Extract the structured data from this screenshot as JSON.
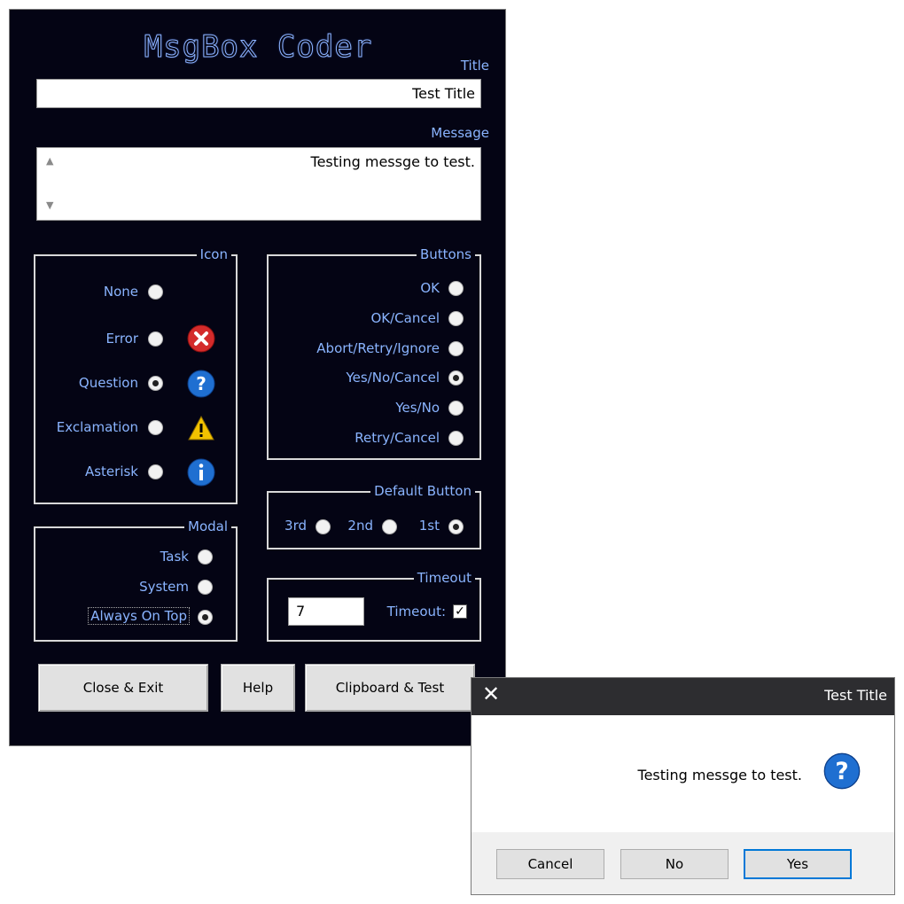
{
  "app": {
    "title": "MsgBox Coder"
  },
  "fields": {
    "title_label": "Title",
    "title_value": "Test Title",
    "message_label": "Message",
    "message_value": "Testing messge to test."
  },
  "icon_group": {
    "legend": "Icon",
    "options": [
      {
        "label": "None",
        "checked": false,
        "icon": "none"
      },
      {
        "label": "Error",
        "checked": false,
        "icon": "error-icon"
      },
      {
        "label": "Question",
        "checked": true,
        "icon": "question-icon"
      },
      {
        "label": "Exclamation",
        "checked": false,
        "icon": "warning-icon"
      },
      {
        "label": "Asterisk",
        "checked": false,
        "icon": "info-icon"
      }
    ]
  },
  "buttons_group": {
    "legend": "Buttons",
    "options": [
      {
        "label": "OK",
        "checked": false
      },
      {
        "label": "OK/Cancel",
        "checked": false
      },
      {
        "label": "Abort/Retry/Ignore",
        "checked": false
      },
      {
        "label": "Yes/No/Cancel",
        "checked": true
      },
      {
        "label": "Yes/No",
        "checked": false
      },
      {
        "label": "Retry/Cancel",
        "checked": false
      }
    ]
  },
  "default_button_group": {
    "legend": "Default Button",
    "options": [
      {
        "label": "1st",
        "checked": true
      },
      {
        "label": "2nd",
        "checked": false
      },
      {
        "label": "3rd",
        "checked": false
      }
    ]
  },
  "modal_group": {
    "legend": "Modal",
    "options": [
      {
        "label": "Task",
        "checked": false
      },
      {
        "label": "System",
        "checked": false
      },
      {
        "label": "Always On Top",
        "checked": true
      }
    ]
  },
  "timeout_group": {
    "legend": "Timeout",
    "checkbox_label": "Timeout:",
    "checked": true,
    "value": "7"
  },
  "actions": {
    "clipboard_test": "Clipboard & Test",
    "help": "Help",
    "close_exit": "Close & Exit"
  },
  "dialog": {
    "title": "Test Title",
    "message": "Testing messge to test.",
    "icon": "question-icon",
    "buttons": [
      "Yes",
      "No",
      "Cancel"
    ],
    "default_button": "Yes"
  },
  "colors": {
    "window_bg": "#040414",
    "label_text": "#8ab4ff",
    "dialog_titlebar": "#2d2d30",
    "focus_border": "#0078d7"
  }
}
